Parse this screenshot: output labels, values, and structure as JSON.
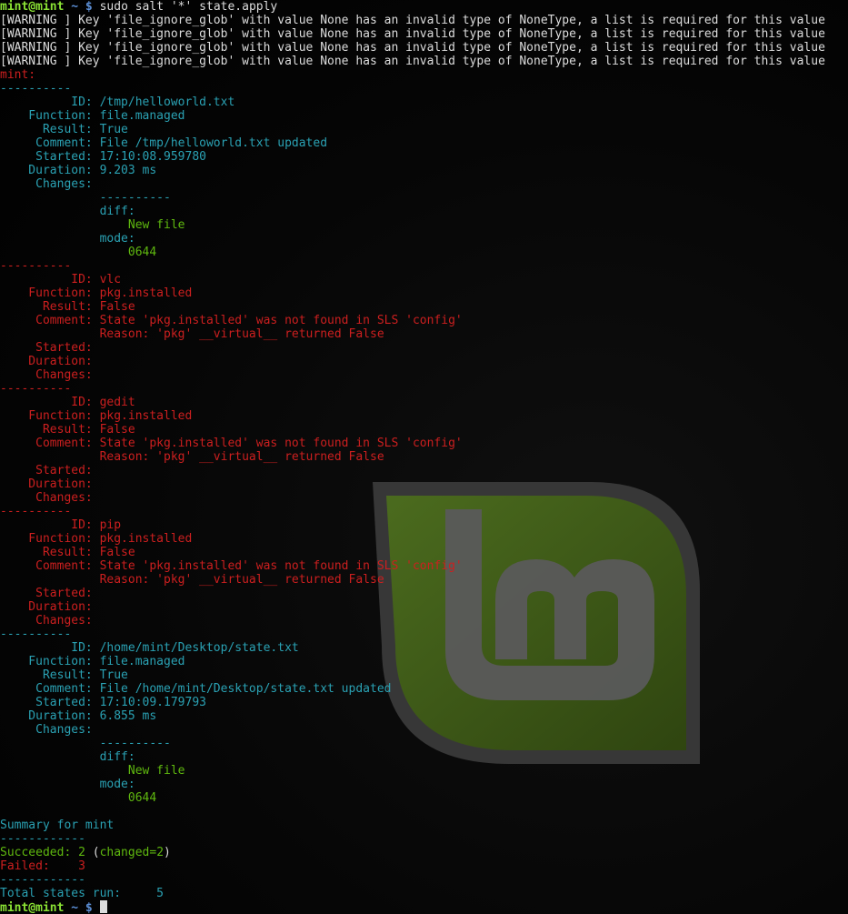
{
  "colors": {
    "background": "#000000",
    "text": "#dcdcdc",
    "error": "#cc1f1f",
    "info": "#2aa1b3",
    "success": "#5fb80f",
    "prompt": "#8ae234"
  },
  "wallpaper": {
    "icon": "linux-mint-logo"
  },
  "terminal": {
    "prompt_user": "mint@mint",
    "prompt_dir": " ~ $",
    "command": " sudo salt '*' state.apply",
    "cursor": "block-cursor",
    "lines": [
      {
        "text": "[WARNING ] Key 'file_ignore_glob' with value None has an invalid type of NoneType, a list is required for this value",
        "color": "white"
      },
      {
        "text": "[WARNING ] Key 'file_ignore_glob' with value None has an invalid type of NoneType, a list is required for this value",
        "color": "white"
      },
      {
        "text": "[WARNING ] Key 'file_ignore_glob' with value None has an invalid type of NoneType, a list is required for this value",
        "color": "white"
      },
      {
        "text": "[WARNING ] Key 'file_ignore_glob' with value None has an invalid type of NoneType, a list is required for this value",
        "color": "white"
      },
      {
        "text": "mint:",
        "color": "red"
      },
      {
        "text": "----------",
        "color": "cyan"
      },
      {
        "text": "          ID: /tmp/helloworld.txt",
        "color": "cyan"
      },
      {
        "text": "    Function: file.managed",
        "color": "cyan"
      },
      {
        "text": "      Result: True",
        "color": "cyan"
      },
      {
        "text": "     Comment: File /tmp/helloworld.txt updated",
        "color": "cyan"
      },
      {
        "text": "     Started: 17:10:08.959780",
        "color": "cyan"
      },
      {
        "text": "    Duration: 9.203 ms",
        "color": "cyan"
      },
      {
        "text": "     Changes:",
        "color": "cyan"
      },
      {
        "text": "              ----------",
        "color": "cyan"
      },
      {
        "text": "              diff:",
        "color": "cyan",
        "head": "              ",
        "body": "diff",
        "tail": ":"
      },
      {
        "text": "                  New file",
        "color": "green"
      },
      {
        "text": "              mode:",
        "color": "cyan",
        "head": "              ",
        "body": "mode",
        "tail": ":"
      },
      {
        "text": "                  0644",
        "color": "green"
      },
      {
        "text": "----------",
        "color": "red"
      },
      {
        "text": "          ID: vlc",
        "color": "red"
      },
      {
        "text": "    Function: pkg.installed",
        "color": "red"
      },
      {
        "text": "      Result: False",
        "color": "red"
      },
      {
        "text": "     Comment: State 'pkg.installed' was not found in SLS 'config'",
        "color": "red"
      },
      {
        "text": "              Reason: 'pkg' __virtual__ returned False",
        "color": "red"
      },
      {
        "text": "     Started:",
        "color": "red"
      },
      {
        "text": "    Duration:",
        "color": "red"
      },
      {
        "text": "     Changes:",
        "color": "red"
      },
      {
        "text": "----------",
        "color": "red"
      },
      {
        "text": "          ID: gedit",
        "color": "red"
      },
      {
        "text": "    Function: pkg.installed",
        "color": "red"
      },
      {
        "text": "      Result: False",
        "color": "red"
      },
      {
        "text": "     Comment: State 'pkg.installed' was not found in SLS 'config'",
        "color": "red"
      },
      {
        "text": "              Reason: 'pkg' __virtual__ returned False",
        "color": "red"
      },
      {
        "text": "     Started:",
        "color": "red"
      },
      {
        "text": "    Duration:",
        "color": "red"
      },
      {
        "text": "     Changes:",
        "color": "red"
      },
      {
        "text": "----------",
        "color": "red"
      },
      {
        "text": "          ID: pip",
        "color": "red"
      },
      {
        "text": "    Function: pkg.installed",
        "color": "red"
      },
      {
        "text": "      Result: False",
        "color": "red"
      },
      {
        "text": "     Comment: State 'pkg.installed' was not found in SLS 'config'",
        "color": "red"
      },
      {
        "text": "              Reason: 'pkg' __virtual__ returned False",
        "color": "red"
      },
      {
        "text": "     Started:",
        "color": "red"
      },
      {
        "text": "    Duration:",
        "color": "red"
      },
      {
        "text": "     Changes:",
        "color": "red"
      },
      {
        "text": "----------",
        "color": "cyan"
      },
      {
        "text": "          ID: /home/mint/Desktop/state.txt",
        "color": "cyan"
      },
      {
        "text": "    Function: file.managed",
        "color": "cyan"
      },
      {
        "text": "      Result: True",
        "color": "cyan"
      },
      {
        "text": "     Comment: File /home/mint/Desktop/state.txt updated",
        "color": "cyan"
      },
      {
        "text": "     Started: 17:10:09.179793",
        "color": "cyan"
      },
      {
        "text": "    Duration: 6.855 ms",
        "color": "cyan"
      },
      {
        "text": "     Changes:",
        "color": "cyan"
      },
      {
        "text": "              ----------",
        "color": "cyan"
      },
      {
        "text": "              diff:",
        "color": "cyan",
        "head": "              ",
        "body": "diff",
        "tail": ":"
      },
      {
        "text": "                  New file",
        "color": "green"
      },
      {
        "text": "              mode:",
        "color": "cyan",
        "head": "              ",
        "body": "mode",
        "tail": ":"
      },
      {
        "text": "                  0644",
        "color": "green"
      },
      {
        "text": "",
        "color": "white"
      },
      {
        "text": "Summary for mint",
        "color": "cyan"
      },
      {
        "text": "------------",
        "color": "cyan"
      },
      {
        "text": "Succeeded: 2 (changed=2)",
        "color": "mixed",
        "segments": [
          {
            "t": "Succeeded: 2",
            "c": "green"
          },
          {
            "t": " (",
            "c": "white"
          },
          {
            "t": "changed=2",
            "c": "green"
          },
          {
            "t": ")",
            "c": "white"
          }
        ]
      },
      {
        "text": "Failed:    3",
        "color": "red"
      },
      {
        "text": "------------",
        "color": "cyan"
      },
      {
        "text": "Total states run:     5",
        "color": "cyan"
      }
    ]
  }
}
